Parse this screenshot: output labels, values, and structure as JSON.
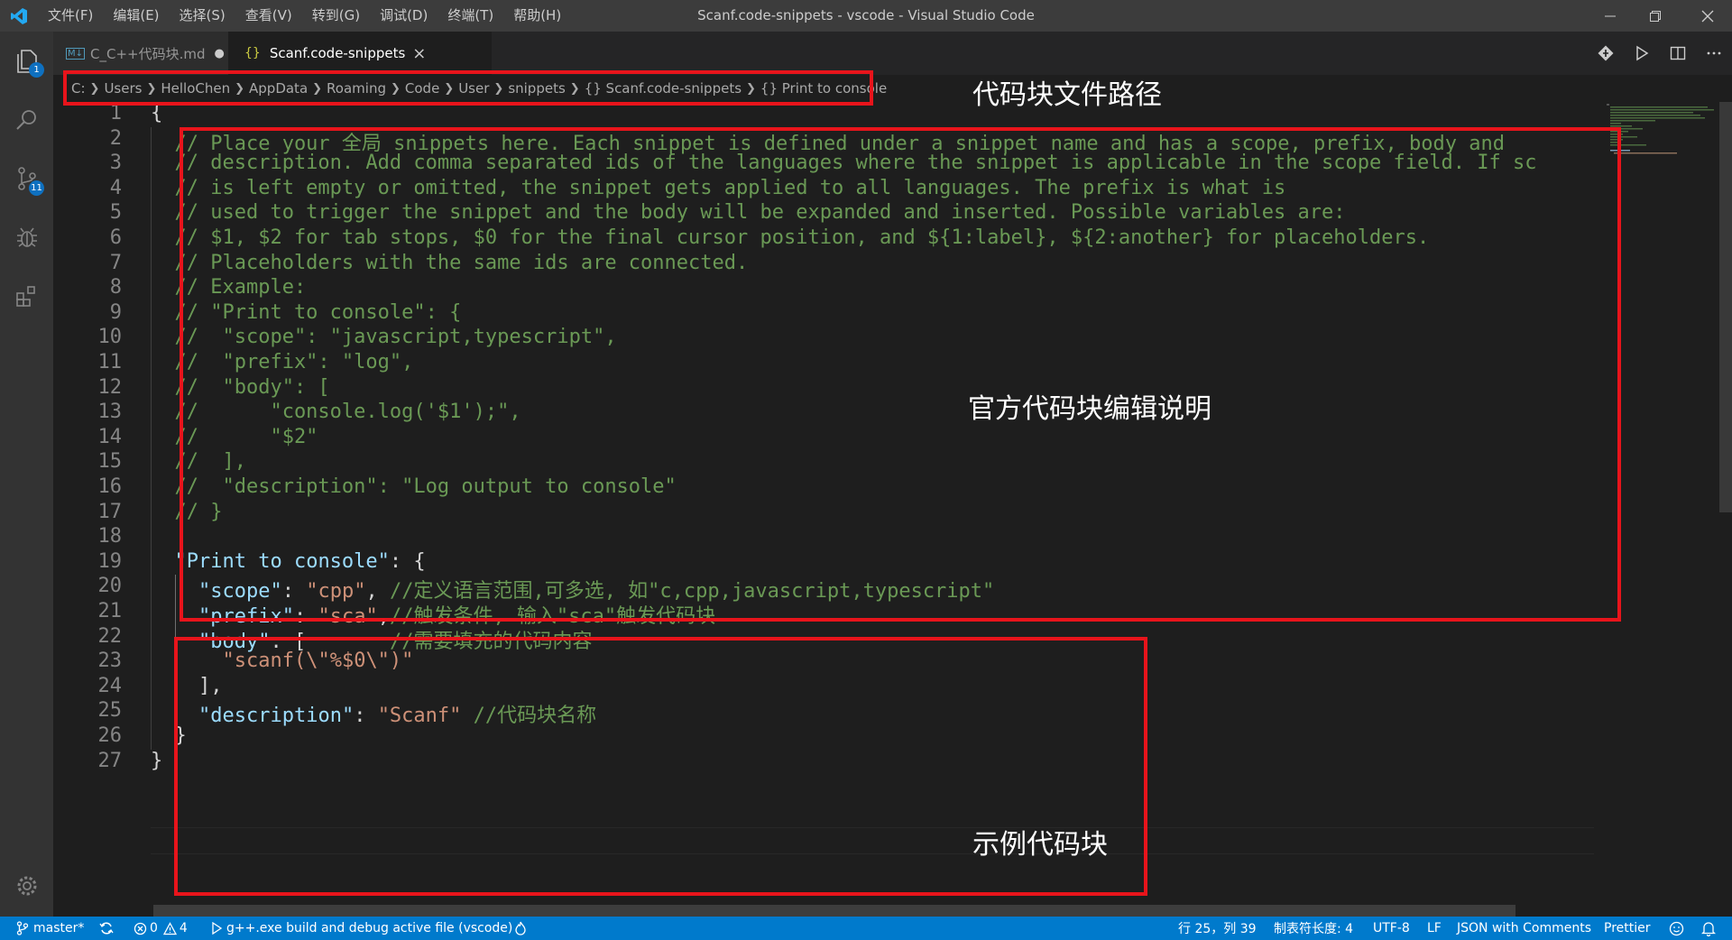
{
  "menu": [
    "文件(F)",
    "编辑(E)",
    "选择(S)",
    "查看(V)",
    "转到(G)",
    "调试(D)",
    "终端(T)",
    "帮助(H)"
  ],
  "window_title": "Scanf.code-snippets - vscode - Visual Studio Code",
  "activity": {
    "explorer_badge": "1",
    "scm_badge": "11"
  },
  "tabs": [
    {
      "icon": "M↓",
      "label": "C_C++代码块.md",
      "modified": "●"
    },
    {
      "icon": "{}",
      "label": "Scanf.code-snippets",
      "close": "×"
    }
  ],
  "breadcrumb": [
    "C:",
    "Users",
    "HelloChen",
    "AppData",
    "Roaming",
    "Code",
    "User",
    "snippets",
    "{} Scanf.code-snippets",
    "{} Print to console"
  ],
  "code_lines": [
    {
      "n": "1",
      "t": "{"
    },
    {
      "n": "2",
      "t": "  // Place your 全局 snippets here. Each snippet is defined under a snippet name and has a scope, prefix, body and"
    },
    {
      "n": "3",
      "t": "  // description. Add comma separated ids of the languages where the snippet is applicable in the scope field. If sc"
    },
    {
      "n": "4",
      "t": "  // is left empty or omitted, the snippet gets applied to all languages. The prefix is what is"
    },
    {
      "n": "5",
      "t": "  // used to trigger the snippet and the body will be expanded and inserted. Possible variables are:"
    },
    {
      "n": "6",
      "t": "  // $1, $2 for tab stops, $0 for the final cursor position, and ${1:label}, ${2:another} for placeholders."
    },
    {
      "n": "7",
      "t": "  // Placeholders with the same ids are connected."
    },
    {
      "n": "8",
      "t": "  // Example:"
    },
    {
      "n": "9",
      "t": "  // \"Print to console\": {"
    },
    {
      "n": "10",
      "t": "  //  \"scope\": \"javascript,typescript\","
    },
    {
      "n": "11",
      "t": "  //  \"prefix\": \"log\","
    },
    {
      "n": "12",
      "t": "  //  \"body\": ["
    },
    {
      "n": "13",
      "t": "  //      \"console.log('$1');\","
    },
    {
      "n": "14",
      "t": "  //      \"$2\""
    },
    {
      "n": "15",
      "t": "  //  ],"
    },
    {
      "n": "16",
      "t": "  //  \"description\": \"Log output to console\""
    },
    {
      "n": "17",
      "t": "  // }"
    },
    {
      "n": "18",
      "t": ""
    },
    {
      "n": "19",
      "t": "  \"Print to console\": {"
    },
    {
      "n": "20",
      "t": "    \"scope\": \"cpp\", //定义语言范围,可多选, 如\"c,cpp,javascript,typescript\""
    },
    {
      "n": "21",
      "t": "    \"prefix\": \"sca\",//触发条件, 输入\"sca\"触发代码块"
    },
    {
      "n": "22",
      "t": "    \"body\": [       //需要填充的代码内容"
    },
    {
      "n": "23",
      "t": "      \"scanf(\\\"%$0\\\")\""
    },
    {
      "n": "24",
      "t": "    ],"
    },
    {
      "n": "25",
      "t": "    \"description\": \"Scanf\" //代码块名称"
    },
    {
      "n": "26",
      "t": "  }"
    },
    {
      "n": "27",
      "t": "}"
    }
  ],
  "annotations": {
    "path": "代码块文件路径",
    "official": "官方代码块编辑说明",
    "example": "示例代码块"
  },
  "status": {
    "branch": "master*",
    "errors": "0",
    "warnings": "4",
    "task": "g++.exe build and debug active file (vscode)",
    "position": "行 25，列 39",
    "indent": "制表符长度: 4",
    "encoding": "UTF-8",
    "eol": "LF",
    "language": "JSON with Comments",
    "formatter": "Prettier"
  },
  "colors": {
    "accent": "#007acc",
    "annotation_border": "#e8141b",
    "comment": "#6a9955",
    "string": "#ce9178",
    "key": "#9cdcfe"
  }
}
